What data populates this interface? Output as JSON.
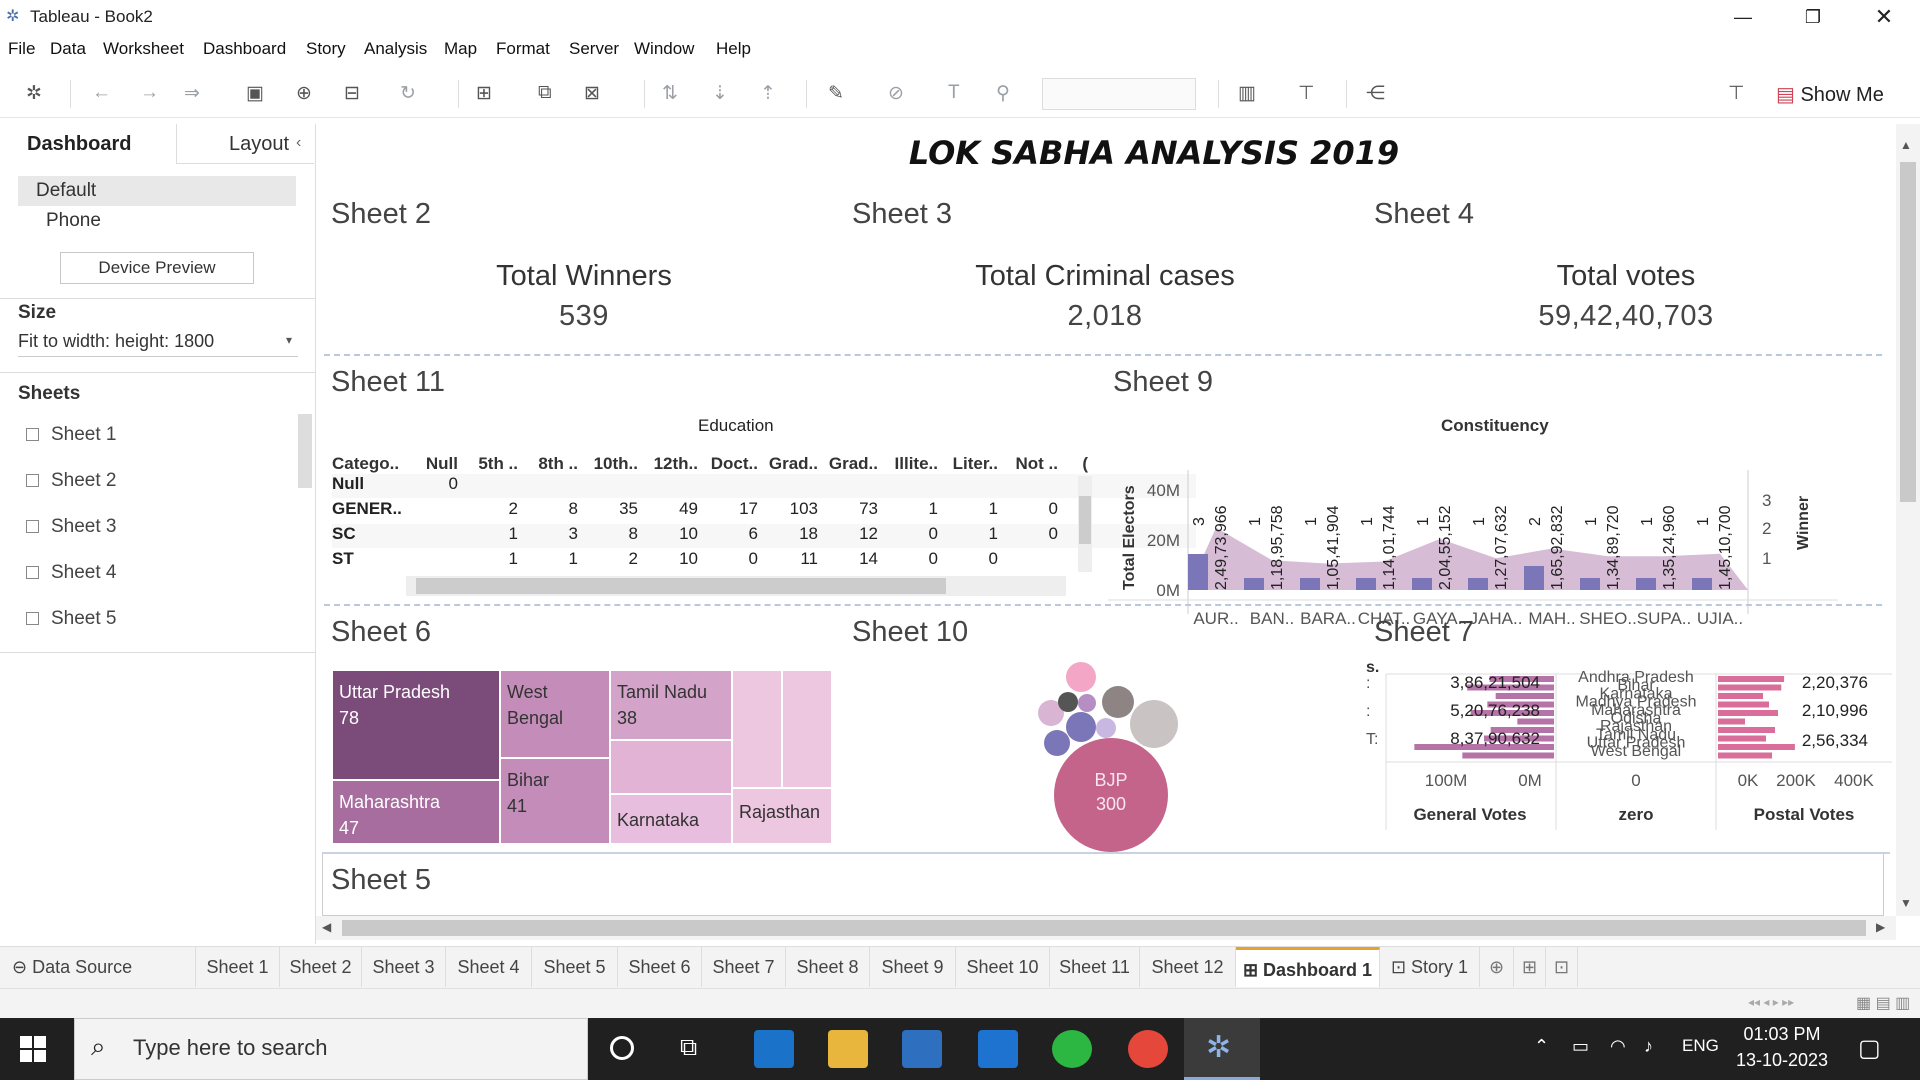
{
  "window": {
    "title": "Tableau - Book2"
  },
  "menu": [
    "File",
    "Data",
    "Worksheet",
    "Dashboard",
    "Story",
    "Analysis",
    "Map",
    "Format",
    "Server",
    "Window",
    "Help"
  ],
  "toolbar": {
    "show_me": "Show Me"
  },
  "left_panel": {
    "tab_dashboard": "Dashboard",
    "tab_layout": "Layout",
    "device_default": "Default",
    "device_phone": "Phone",
    "device_preview": "Device Preview",
    "size_heading": "Size",
    "size_value": "Fit to width: height: 1800",
    "sheets_heading": "Sheets",
    "sheets": [
      "Sheet 1",
      "Sheet 2",
      "Sheet 3",
      "Sheet 4",
      "Sheet 5"
    ]
  },
  "dashboard": {
    "title": "LOK SABHA ANALYSIS 2019",
    "sheet2": {
      "name": "Sheet 2",
      "label": "Total Winners",
      "value": "539"
    },
    "sheet3": {
      "name": "Sheet 3",
      "label": "Total Criminal cases",
      "value": "2,018"
    },
    "sheet4": {
      "name": "Sheet 4",
      "label": "Total votes",
      "value": "59,42,40,703"
    },
    "sheet11": {
      "name": "Sheet 11",
      "group_header": "Education",
      "columns": [
        "Catego..",
        "Null",
        "5th ..",
        "8th ..",
        "10th..",
        "12th..",
        "Doct..",
        "Grad..",
        "Grad..",
        "Illite..",
        "Liter..",
        "Not ..",
        "("
      ],
      "rows": [
        [
          "Null",
          "0",
          "",
          "",
          "",
          "",
          "",
          "",
          "",
          "",
          "",
          ""
        ],
        [
          "GENER..",
          "",
          "2",
          "8",
          "35",
          "49",
          "17",
          "103",
          "73",
          "1",
          "1",
          "0"
        ],
        [
          "SC",
          "",
          "1",
          "3",
          "8",
          "10",
          "6",
          "18",
          "12",
          "0",
          "1",
          "0"
        ],
        [
          "ST",
          "",
          "1",
          "1",
          "2",
          "10",
          "0",
          "11",
          "14",
          "0",
          "0",
          ""
        ]
      ]
    },
    "sheet9": {
      "name": "Sheet 9",
      "header": "Constituency",
      "y_label": "Total Electors",
      "y2_label": "Winner",
      "y_ticks": [
        "40M",
        "20M",
        "0M"
      ],
      "y2_ticks": [
        "3",
        "2",
        "1"
      ],
      "categories": [
        "AUR..",
        "BAN..",
        "BARA..",
        "CHAT..",
        "GAYA..",
        "JAHA..",
        "MAH..",
        "SHEO..",
        "SUPA..",
        "UJIA.."
      ],
      "winner_labels": [
        "3",
        "1",
        "1",
        "1",
        "1",
        "1",
        "2",
        "1",
        "1",
        "1"
      ],
      "elector_labels": [
        "2,49,73,966",
        "1,18,95,758",
        "1,05,41,904",
        "1,14,01,744",
        "2,04,55,152",
        "1,27,07,632",
        "1,65,92,832",
        "1,34,89,720",
        "1,35,24,960",
        "1,45,10,700"
      ]
    },
    "sheet6": {
      "name": "Sheet 6",
      "tiles": [
        {
          "label": "Uttar Pradesh",
          "value": "78"
        },
        {
          "label": "West Bengal",
          "value": ""
        },
        {
          "label": "Tamil Nadu",
          "value": "38"
        },
        {
          "label": "Maharashtra",
          "value": "47"
        },
        {
          "label": "Bihar",
          "value": "41"
        },
        {
          "label": "Karnataka",
          "value": ""
        },
        {
          "label": "Rajasthan",
          "value": ""
        }
      ]
    },
    "sheet10": {
      "name": "Sheet 10",
      "big_label": "BJP",
      "big_value": "300"
    },
    "sheet7": {
      "name": "Sheet 7",
      "col_header_left": "s.",
      "general_votes_labels": [
        "3,86,21,504",
        "5,20,76,238",
        "8,37,90,632"
      ],
      "row_marks": [
        ":",
        ":",
        "T:"
      ],
      "states": [
        "Andhra Pradesh",
        "Bihar",
        "Karnataka",
        "Madhya Pradesh",
        "Maharashtra",
        "Odisha",
        "Rajasthan",
        "Tamil Nadu",
        "Uttar Pradesh",
        "West Bengal"
      ],
      "postal_votes_labels": [
        "2,20,376",
        "2,10,996",
        "2,56,334"
      ],
      "general_ticks": [
        "100M",
        "0M"
      ],
      "zero_tick": "0",
      "postal_ticks": [
        "0K",
        "200K",
        "400K"
      ],
      "axis_general": "General Votes",
      "axis_zero": "zero",
      "axis_postal": "Postal Votes"
    },
    "sheet5": {
      "name": "Sheet 5"
    }
  },
  "tabs": [
    "Data Source",
    "Sheet 1",
    "Sheet 2",
    "Sheet 3",
    "Sheet 4",
    "Sheet 5",
    "Sheet 6",
    "Sheet 7",
    "Sheet 8",
    "Sheet 9",
    "Sheet 10",
    "Sheet 11",
    "Sheet 12",
    "Dashboard 1",
    "Story 1"
  ],
  "taskbar": {
    "search_placeholder": "Type here to search",
    "lang": "ENG",
    "time": "01:03 PM",
    "date": "13-10-2023"
  },
  "colors": {
    "purple_dark": "#7b4b7a",
    "purple_mid": "#c48db9",
    "pink_light": "#edc6e0",
    "bjp": "#c4648b",
    "area_fill": "#c9a6c8",
    "bar_blue": "#7b76b8"
  },
  "chart_data": [
    {
      "type": "area",
      "title": "Sheet 9",
      "xlabel": "Constituency",
      "ylabel": "Total Electors",
      "categories": [
        "AUR..",
        "BAN..",
        "BARA..",
        "CHAT..",
        "GAYA..",
        "JAHA..",
        "MAH..",
        "SHEO..",
        "SUPA..",
        "UJIA.."
      ],
      "series": [
        {
          "name": "Total Electors",
          "values": [
            24973966,
            11895758,
            10541904,
            11401744,
            20455152,
            12707632,
            16592832,
            13489720,
            13524960,
            14510700
          ]
        },
        {
          "name": "Winner",
          "values": [
            3,
            1,
            1,
            1,
            1,
            1,
            2,
            1,
            1,
            1
          ]
        }
      ],
      "ylim": [
        0,
        40000000
      ]
    },
    {
      "type": "bar",
      "title": "Sheet 7",
      "categories": [
        "Andhra Pradesh",
        "Bihar",
        "Karnataka",
        "Madhya Pradesh",
        "Maharashtra",
        "Odisha",
        "Rajasthan",
        "Tamil Nadu",
        "Uttar Pradesh",
        "West Bengal"
      ],
      "series": [
        {
          "name": "General Votes",
          "values": [
            38621504,
            52076238,
            35000000,
            40000000,
            50000000,
            22000000,
            38000000,
            42000000,
            83790632,
            55000000
          ]
        },
        {
          "name": "Postal Votes",
          "values": [
            220376,
            210996,
            150000,
            170000,
            200000,
            90000,
            190000,
            160000,
            256334,
            180000
          ]
        }
      ]
    }
  ]
}
